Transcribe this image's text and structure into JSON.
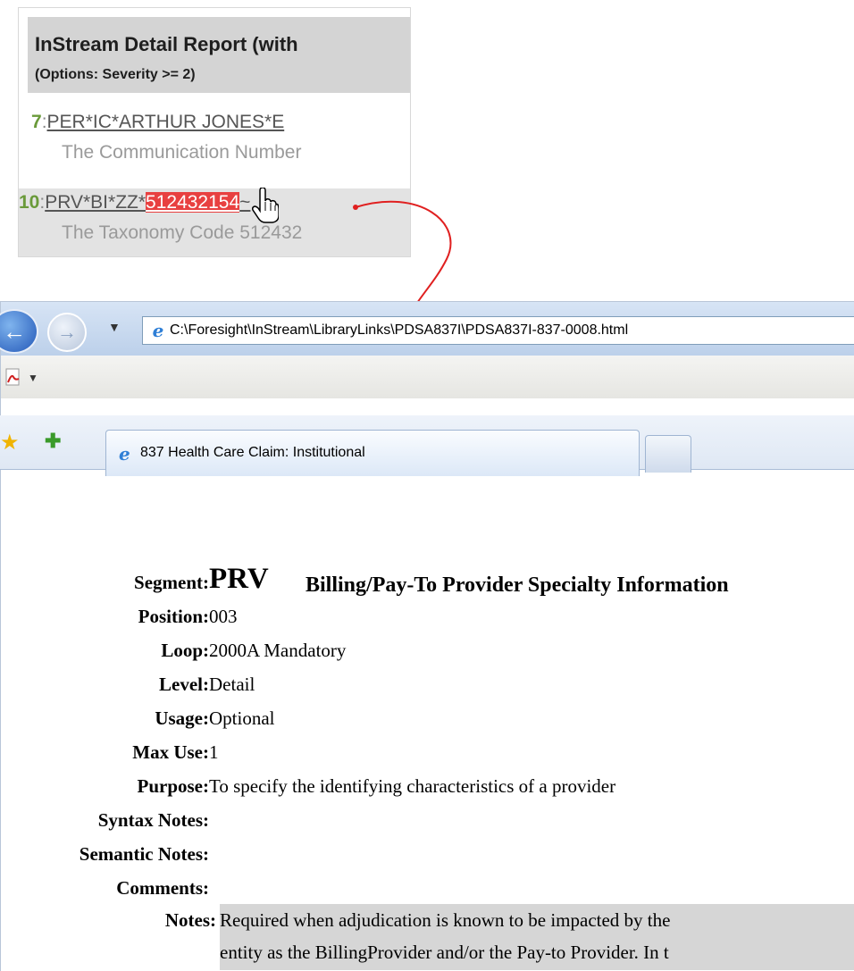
{
  "report": {
    "title": "InStream Detail Report (with",
    "options": "(Options: Severity >= 2)",
    "lines": [
      {
        "num": "7",
        "segment": "PER*IC*ARTHUR JONES*E",
        "desc": "The Communication Number"
      },
      {
        "num": "10",
        "segment_prefix": "PRV*BI*ZZ*",
        "segment_highlight": "512432154",
        "segment_suffix": "~",
        "desc": "The Taxonomy Code 512432"
      }
    ]
  },
  "browser": {
    "address": "C:\\Foresight\\InStream\\LibraryLinks\\PDSA837I\\PDSA837I-837-0008.html",
    "tab_title": "837 Health Care Claim: Institutional"
  },
  "segment": {
    "labels": {
      "segment": "Segment:",
      "position": "Position:",
      "loop": "Loop:",
      "level": "Level:",
      "usage": "Usage:",
      "max_use": "Max Use:",
      "purpose": "Purpose:",
      "syntax_notes": "Syntax Notes:",
      "semantic_notes": "Semantic Notes:",
      "comments": "Comments:",
      "notes": "Notes:"
    },
    "code": "PRV",
    "name": "Billing/Pay-To Provider Specialty Information",
    "position": "003",
    "loop": "2000A Mandatory",
    "level": "Detail",
    "usage": "Optional",
    "max_use": "1",
    "purpose": "To specify the identifying characteristics of a provider",
    "notes_line1": "Required when adjudication is known to be impacted by the",
    "notes_line2": "entity as the BillingProvider and/or the Pay-to Provider. In t"
  },
  "colors": {
    "error_highlight": "#e84040",
    "arrow": "#e02020",
    "line_number": "#6a9a3a"
  }
}
